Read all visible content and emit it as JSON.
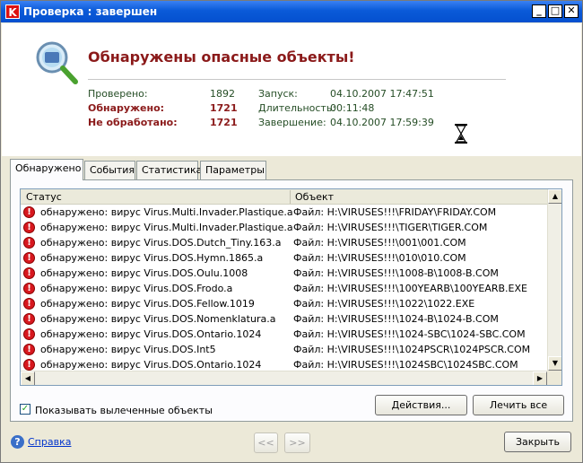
{
  "window": {
    "title": "Проверка : завершен",
    "buttons": {
      "minimize": "_",
      "maximize": "□",
      "close": "✕"
    }
  },
  "header": {
    "title": "Обнаружены опасные объекты!",
    "stats": {
      "checked_label": "Проверено:",
      "checked_value": "1892",
      "detected_label": "Обнаружено:",
      "detected_value": "1721",
      "unprocessed_label": "Не обработано:",
      "unprocessed_value": "1721",
      "start_label": "Запуск:",
      "start_value": "04.10.2007 17:47:51",
      "duration_label": "Длительность:",
      "duration_value": "00:11:48",
      "finish_label": "Завершение:",
      "finish_value": "04.10.2007 17:59:39"
    }
  },
  "tabs": [
    "Обнаружено",
    "События",
    "Статистика",
    "Параметры"
  ],
  "list": {
    "columns": [
      "Статус",
      "Объект"
    ],
    "rows": [
      {
        "status": "обнаружено: вирус Virus.Multi.Invader.Plastique.a",
        "object": "Файл: H:\\VIRUSES!!!\\FRIDAY\\FRIDAY.COM"
      },
      {
        "status": "обнаружено: вирус Virus.Multi.Invader.Plastique.a",
        "object": "Файл: H:\\VIRUSES!!!\\TIGER\\TIGER.COM"
      },
      {
        "status": "обнаружено: вирус Virus.DOS.Dutch_Tiny.163.a",
        "object": "Файл: H:\\VIRUSES!!!\\001\\001.COM"
      },
      {
        "status": "обнаружено: вирус Virus.DOS.Hymn.1865.a",
        "object": "Файл: H:\\VIRUSES!!!\\010\\010.COM"
      },
      {
        "status": "обнаружено: вирус Virus.DOS.Oulu.1008",
        "object": "Файл: H:\\VIRUSES!!!\\1008-B\\1008-B.COM"
      },
      {
        "status": "обнаружено: вирус Virus.DOS.Frodo.a",
        "object": "Файл: H:\\VIRUSES!!!\\100YEARB\\100YEARB.EXE"
      },
      {
        "status": "обнаружено: вирус Virus.DOS.Fellow.1019",
        "object": "Файл: H:\\VIRUSES!!!\\1022\\1022.EXE"
      },
      {
        "status": "обнаружено: вирус Virus.DOS.Nomenklatura.a",
        "object": "Файл: H:\\VIRUSES!!!\\1024-B\\1024-B.COM"
      },
      {
        "status": "обнаружено: вирус Virus.DOS.Ontario.1024",
        "object": "Файл: H:\\VIRUSES!!!\\1024-SBC\\1024-SBC.COM"
      },
      {
        "status": "обнаружено: вирус Virus.DOS.Int5",
        "object": "Файл: H:\\VIRUSES!!!\\1024PSCR\\1024PSCR.COM"
      },
      {
        "status": "обнаружено: вирус Virus.DOS.Ontario.1024",
        "object": "Файл: H:\\VIRUSES!!!\\1024SBC\\1024SBC.COM"
      }
    ]
  },
  "buttons": {
    "actions": "Действия...",
    "cure_all": "Лечить все",
    "prev": "<<",
    "next": ">>",
    "close": "Закрыть"
  },
  "show_cured": {
    "label": "Показывать вылеченные объекты",
    "checked": true
  },
  "help": {
    "label": "Справка"
  },
  "icons": {
    "app": "kaspersky-icon",
    "header": "magnifier-icon",
    "busy": "hourglass-icon",
    "row": "danger-icon",
    "help": "help-icon"
  },
  "colors": {
    "alert_title": "#8b1a1a",
    "danger": "#d7181f",
    "titlebar": "#0a5ad8"
  }
}
